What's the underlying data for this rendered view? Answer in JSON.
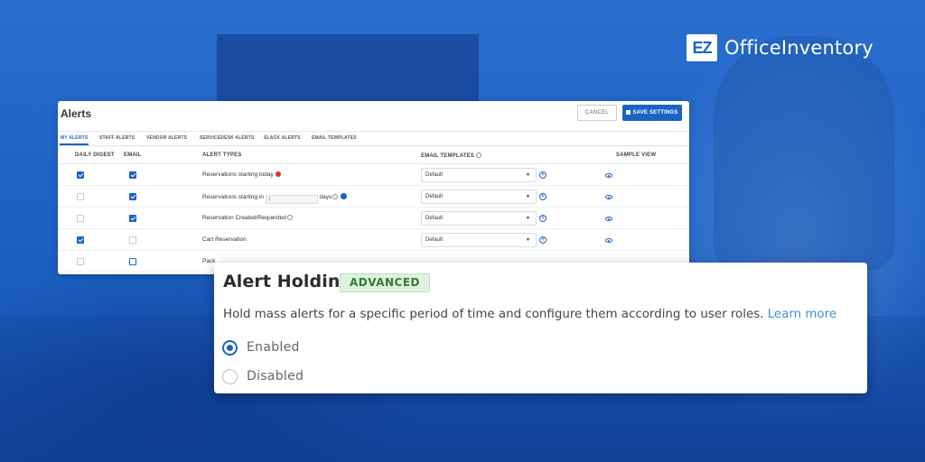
{
  "brand": {
    "logo_mark": "EZ",
    "name": "OfficeInventory"
  },
  "alerts_panel": {
    "title": "Alerts",
    "cancel_label": "CANCEL",
    "save_label": "SAVE SETTINGS",
    "tabs": [
      {
        "label": "MY ALERTS",
        "active": true
      },
      {
        "label": "STAFF ALERTS",
        "active": false
      },
      {
        "label": "VENDOR ALERTS",
        "active": false
      },
      {
        "label": "SERVICEDESK ALERTS",
        "active": false
      },
      {
        "label": "SLACK ALERTS",
        "active": false
      },
      {
        "label": "EMAIL TEMPLATES",
        "active": false
      }
    ],
    "columns": {
      "daily_digest": "DAILY DIGEST",
      "email": "EMAIL",
      "alert_types": "ALERT TYPES",
      "email_templates": "EMAIL TEMPLATES",
      "sample_view": "SAMPLE VIEW"
    },
    "rows": [
      {
        "daily_digest": true,
        "email": true,
        "alert_type": "Reservations starting today",
        "template": "Default"
      },
      {
        "daily_digest": false,
        "email": true,
        "alert_type": "Reservations starting in",
        "days_value": "1",
        "days_suffix": "days",
        "template": "Default"
      },
      {
        "daily_digest": false,
        "email": true,
        "alert_type": "Reservation Created/Requested",
        "template": "Default"
      },
      {
        "daily_digest": true,
        "email": false,
        "alert_type": "Cart Reservation",
        "template": "Default"
      },
      {
        "daily_digest": false,
        "email": false,
        "alert_type": "Pack"
      }
    ]
  },
  "alert_holding": {
    "title": "Alert Holding",
    "badge": "ADVANCED",
    "badge_color": "#2f7d3a",
    "description": "Hold mass alerts for a specific period of time and configure them according to user roles.",
    "learn_more": "Learn more",
    "options": [
      {
        "label": "Enabled",
        "selected": true
      },
      {
        "label": "Disabled",
        "selected": false
      }
    ]
  },
  "colors": {
    "background": "#1a5fbf",
    "accent": "#1a63c4"
  }
}
